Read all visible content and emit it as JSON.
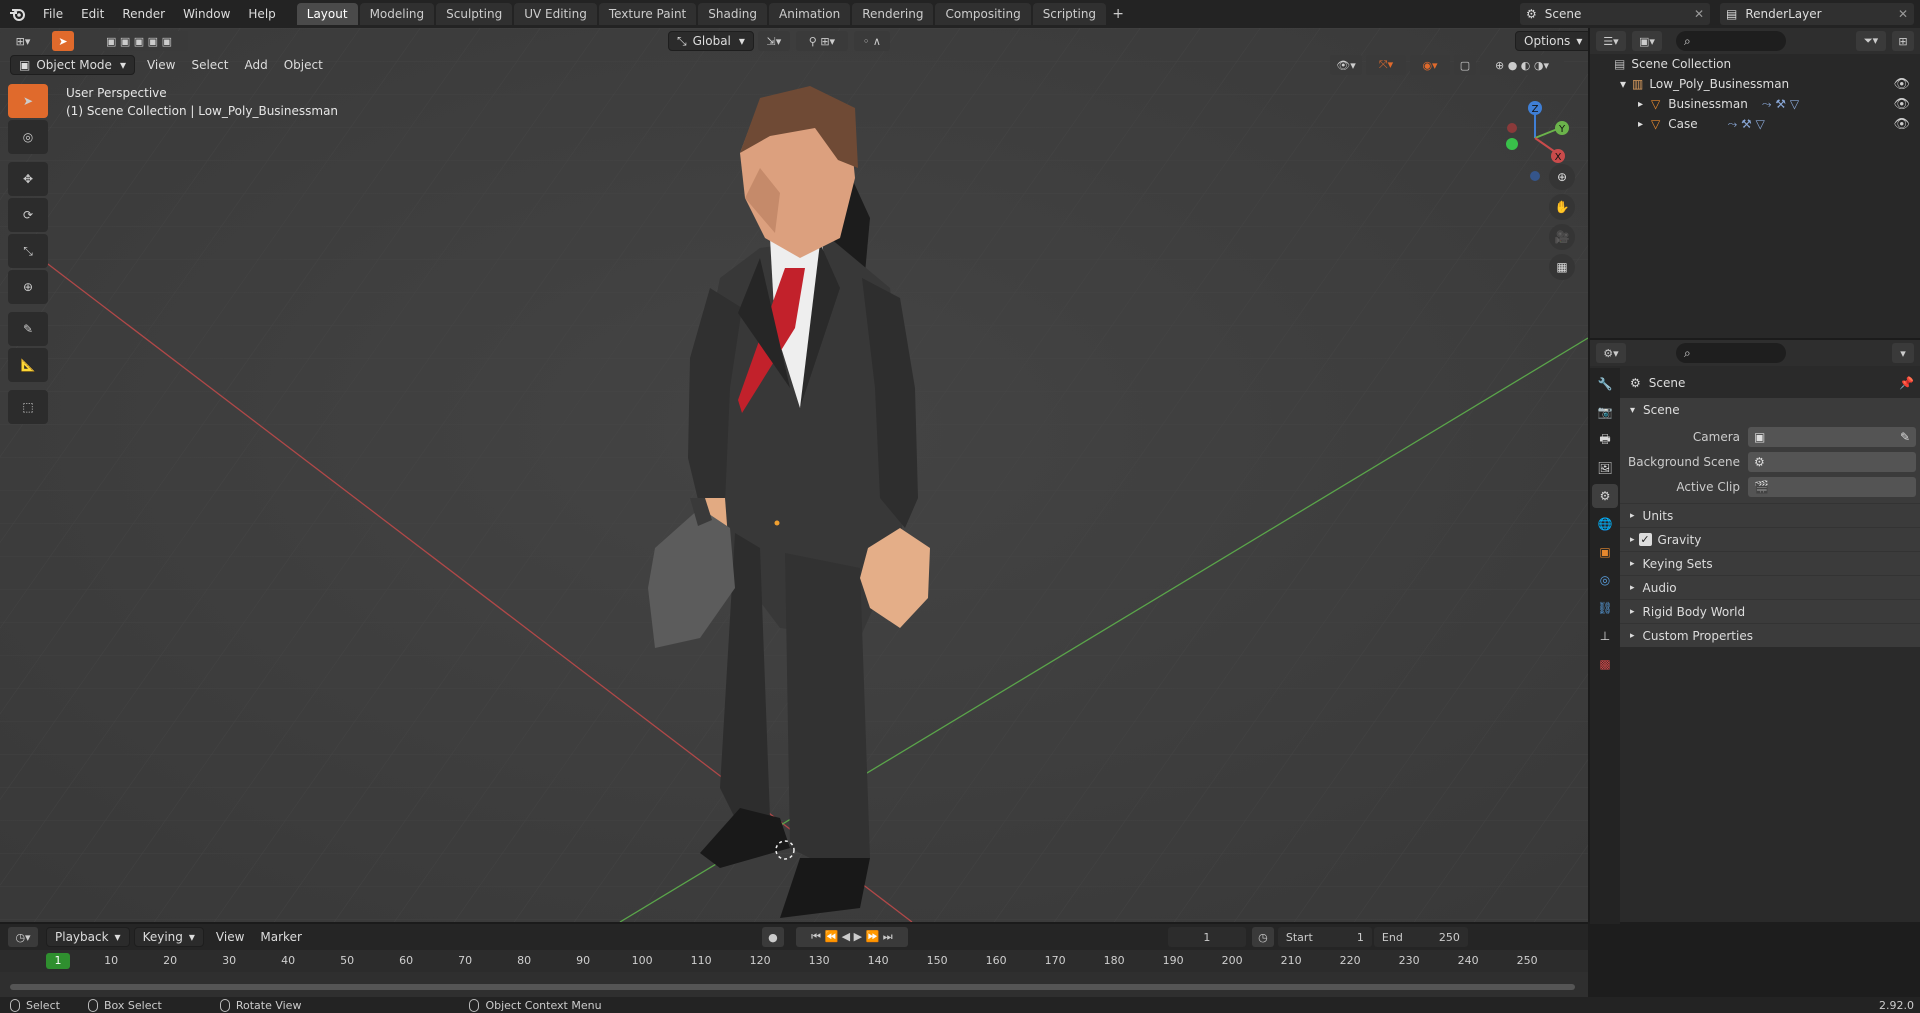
{
  "top_menu": [
    "File",
    "Edit",
    "Render",
    "Window",
    "Help"
  ],
  "workspace_tabs": [
    "Layout",
    "Modeling",
    "Sculpting",
    "UV Editing",
    "Texture Paint",
    "Shading",
    "Animation",
    "Rendering",
    "Compositing",
    "Scripting"
  ],
  "workspace_add": "+",
  "scene_name": "Scene",
  "view_layer_name": "RenderLayer",
  "viewport": {
    "mode": "Object Mode",
    "menus": [
      "View",
      "Select",
      "Add",
      "Object"
    ],
    "transform_orientation": "Global",
    "options": "Options",
    "perspective_label": "User Perspective",
    "collection_label": "(1) Scene Collection | Low_Poly_Businessman",
    "gizmo_axes": {
      "z": "Z",
      "y": "Y",
      "x": "X"
    }
  },
  "outliner": {
    "rows": [
      {
        "label": "Scene Collection"
      },
      {
        "label": "Low_Poly_Businessman"
      },
      {
        "label": "Businessman"
      },
      {
        "label": "Case"
      }
    ]
  },
  "properties": {
    "breadcrumb": "Scene",
    "panel_title": "Scene",
    "fields": [
      {
        "label": "Camera"
      },
      {
        "label": "Background Scene"
      },
      {
        "label": "Active Clip"
      }
    ],
    "subpanels": [
      "Units",
      "Gravity",
      "Keying Sets",
      "Audio",
      "Rigid Body World",
      "Custom Properties"
    ],
    "gravity_checked": true
  },
  "timeline": {
    "menus": [
      "Playback",
      "Keying",
      "View",
      "Marker"
    ],
    "current_frame": "1",
    "start_label": "Start",
    "start_value": "1",
    "end_label": "End",
    "end_value": "250",
    "ruler_ticks": [
      "1",
      "10",
      "20",
      "30",
      "40",
      "50",
      "60",
      "70",
      "80",
      "90",
      "100",
      "110",
      "120",
      "130",
      "140",
      "150",
      "160",
      "170",
      "180",
      "190",
      "200",
      "210",
      "220",
      "230",
      "240",
      "250"
    ]
  },
  "status_bar": {
    "select": "Select",
    "box_select": "Box Select",
    "rotate_view": "Rotate View",
    "context_menu": "Object Context Menu",
    "version": "2.92.0"
  },
  "colors": {
    "accent": "#e06a2c",
    "frame_green": "#2f8f2f",
    "x_axis": "#c94b4b",
    "y_axis": "#6bb34b",
    "z_axis": "#3f7fd6"
  }
}
